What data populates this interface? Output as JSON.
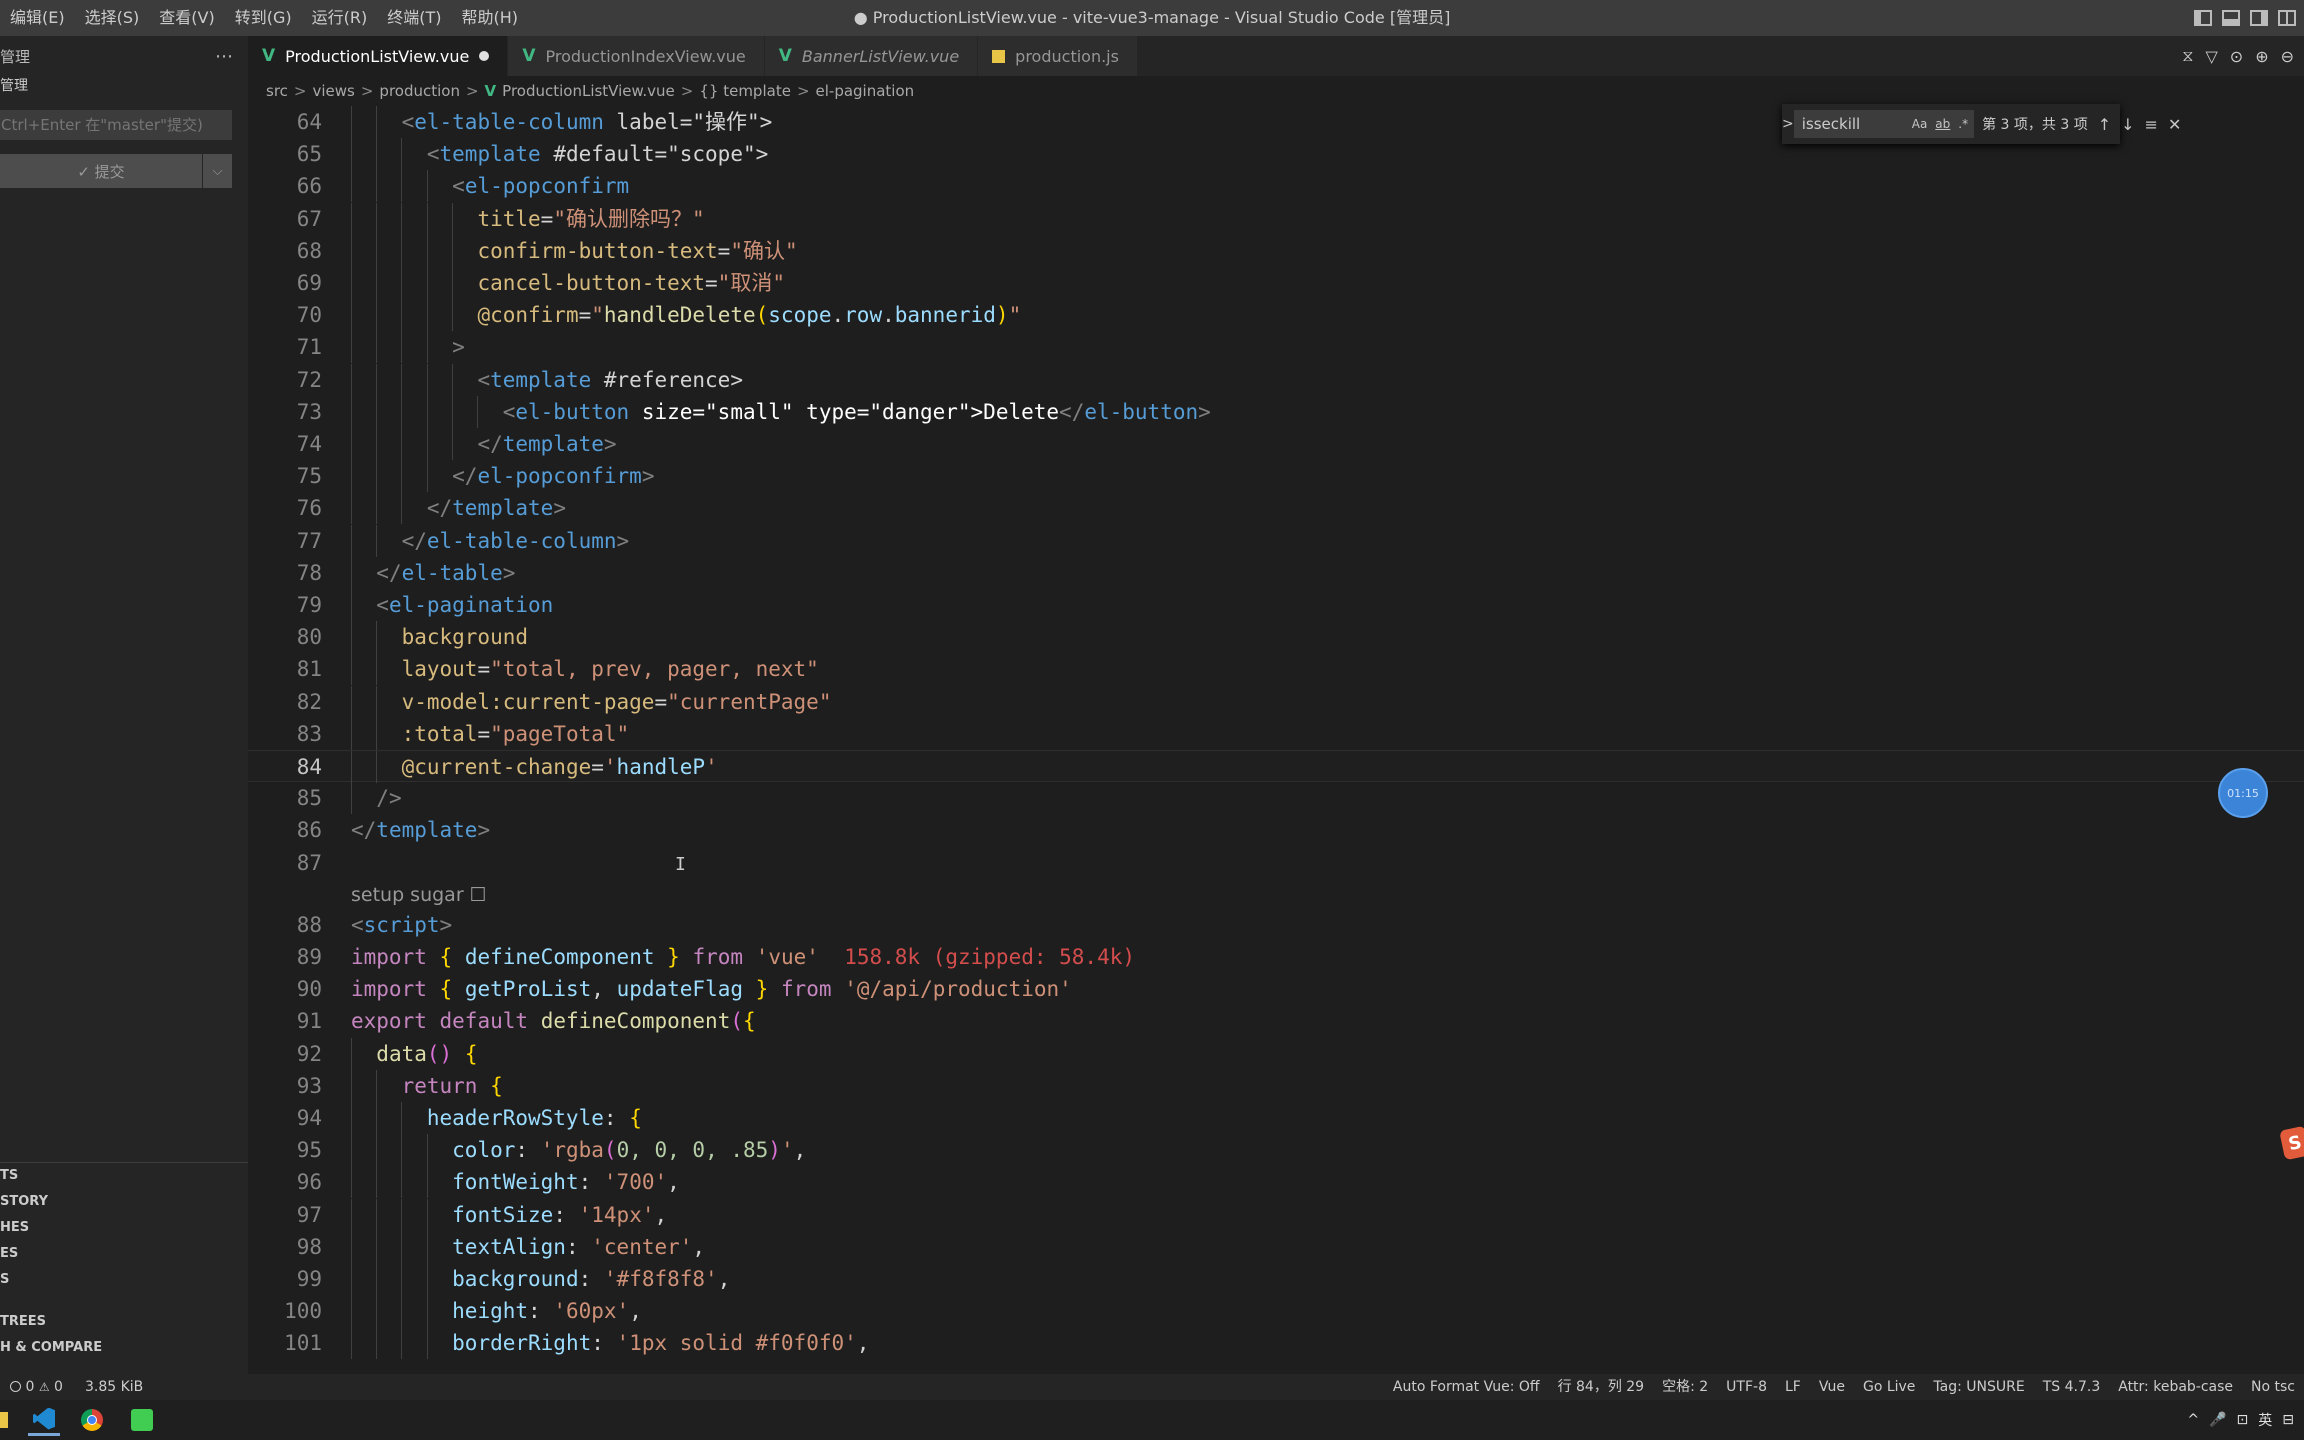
{
  "window": {
    "title": "● ProductionListView.vue - vite-vue3-manage - Visual Studio Code [管理员]",
    "menu": [
      "编辑(E)",
      "选择(S)",
      "查看(V)",
      "转到(G)",
      "运行(R)",
      "终端(T)",
      "帮助(H)"
    ]
  },
  "sidebar": {
    "header": "管理",
    "more_icon": "⋯",
    "subheader": "管理",
    "commit_placeholder": "Ctrl+Enter 在\"master\"提交)",
    "commit_button": "✓ 提交",
    "dropdown_icon": "⌵",
    "sections": [
      "TS",
      "STORY",
      "HES",
      "ES",
      "S",
      "TREES",
      "H & COMPARE"
    ]
  },
  "tabs": [
    {
      "icon": "V",
      "label": "ProductionListView.vue",
      "active": true,
      "dirty": true,
      "italic": false
    },
    {
      "icon": "V",
      "label": "ProductionIndexView.vue",
      "active": false,
      "dirty": false,
      "italic": false
    },
    {
      "icon": "V",
      "label": "BannerListView.vue",
      "active": false,
      "dirty": false,
      "italic": true
    },
    {
      "icon": "JS",
      "label": "production.js",
      "active": false,
      "dirty": false,
      "italic": false
    }
  ],
  "tab_actions": [
    "⧖",
    "▽",
    "⊙",
    "⊕",
    "⊖"
  ],
  "breadcrumb": {
    "items": [
      "src",
      "views",
      "production",
      "ProductionListView.vue",
      "{} template",
      "el-pagination"
    ],
    "separator": ">"
  },
  "find": {
    "toggle": ">",
    "query": "isseckill",
    "opt_case": "Aa",
    "opt_word": "ab",
    "opt_regex": ".*",
    "count": "第 3 项，共 3 项",
    "prev": "↑",
    "next": "↓",
    "selection": "≡",
    "close": "✕"
  },
  "editor": {
    "current_line": "84",
    "codelens": "setup sugar ☐",
    "lines": [
      {
        "n": "64",
        "code": "    <el-table-column label=\"操作\">"
      },
      {
        "n": "65",
        "code": "      <template #default=\"scope\">"
      },
      {
        "n": "66",
        "code": "        <el-popconfirm"
      },
      {
        "n": "67",
        "code": "          title=\"确认删除吗？\""
      },
      {
        "n": "68",
        "code": "          confirm-button-text=\"确认\""
      },
      {
        "n": "69",
        "code": "          cancel-button-text=\"取消\""
      },
      {
        "n": "70",
        "code": "          @confirm=\"handleDelete(scope.row.bannerid)\""
      },
      {
        "n": "71",
        "code": "        >"
      },
      {
        "n": "72",
        "code": "          <template #reference>"
      },
      {
        "n": "73",
        "code": "            <el-button size=\"small\" type=\"danger\">Delete</el-button>"
      },
      {
        "n": "74",
        "code": "          </template>"
      },
      {
        "n": "75",
        "code": "        </el-popconfirm>"
      },
      {
        "n": "76",
        "code": "      </template>"
      },
      {
        "n": "77",
        "code": "    </el-table-column>"
      },
      {
        "n": "78",
        "code": "  </el-table>"
      },
      {
        "n": "79",
        "code": "  <el-pagination"
      },
      {
        "n": "80",
        "code": "    background"
      },
      {
        "n": "81",
        "code": "    layout=\"total, prev, pager, next\""
      },
      {
        "n": "82",
        "code": "    v-model:current-page=\"currentPage\""
      },
      {
        "n": "83",
        "code": "    :total=\"pageTotal\""
      },
      {
        "n": "84",
        "code": "    @current-change='handleP'"
      },
      {
        "n": "85",
        "code": "  />"
      },
      {
        "n": "86",
        "code": "</template>"
      },
      {
        "n": "87",
        "code": ""
      },
      {
        "n": "88",
        "code": "<script>"
      },
      {
        "n": "89",
        "code": "import { defineComponent } from 'vue'  158.8k (gzipped: 58.4k)"
      },
      {
        "n": "90",
        "code": "import { getProList, updateFlag } from '@/api/production'"
      },
      {
        "n": "91",
        "code": "export default defineComponent({"
      },
      {
        "n": "92",
        "code": "  data() {"
      },
      {
        "n": "93",
        "code": "    return {"
      },
      {
        "n": "94",
        "code": "      headerRowStyle: {"
      },
      {
        "n": "95",
        "code": "        color: 'rgba(0, 0, 0, .85)',"
      },
      {
        "n": "96",
        "code": "        fontWeight: '700',"
      },
      {
        "n": "97",
        "code": "        fontSize: '14px',"
      },
      {
        "n": "98",
        "code": "        textAlign: 'center',"
      },
      {
        "n": "99",
        "code": "        background: '#f8f8f8',"
      },
      {
        "n": "100",
        "code": "        height: '60px',"
      },
      {
        "n": "101",
        "code": "        borderRight: '1px solid #f0f0f0',"
      }
    ]
  },
  "overlay": {
    "timer": "01:15",
    "ime": "S",
    "ibeam": "I"
  },
  "statusbar": {
    "errors": "0",
    "warnings": "0",
    "filesize": "3.85 KiB",
    "right": [
      "Auto Format Vue: Off",
      "行 84，列 29",
      "空格: 2",
      "UTF-8",
      "LF",
      "Vue",
      "Go Live",
      "Tag: UNSURE",
      "TS 4.7.3",
      "Attr: kebab-case",
      "No tsc"
    ]
  },
  "taskbar": {
    "tray": [
      "^",
      "🎤",
      "⊡",
      "英",
      "⊟"
    ]
  },
  "colors": {
    "editor_bg": "#1e1e1e",
    "tag": "#569cd6",
    "string": "#ce9178",
    "attribute": "#d7ba7d",
    "keyword": "#c586c0",
    "function": "#dcdcaa",
    "variable": "#9cdcfe",
    "vue_icon": "#41b883"
  }
}
